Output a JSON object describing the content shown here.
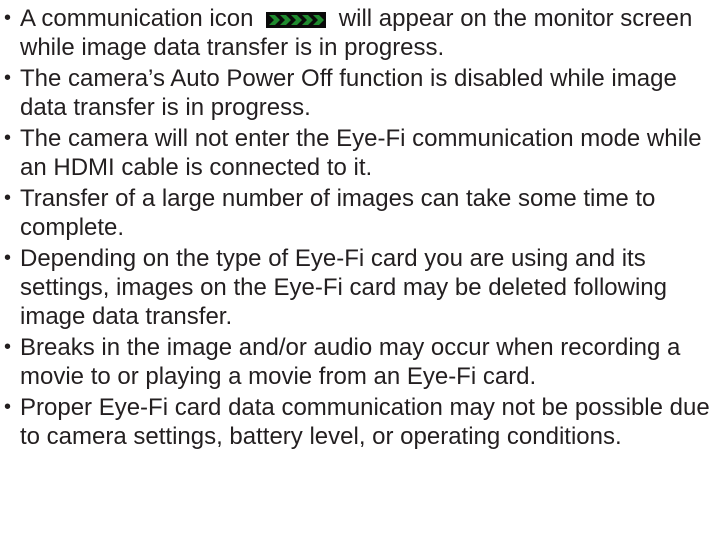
{
  "bullet_char": "•",
  "items": [
    {
      "text_before_icon": "A communication icon",
      "icon": "eye-fi-communication-icon",
      "text_after_icon": "will appear on the monitor screen while image data transfer is in progress."
    },
    {
      "text": "The camera’s Auto Power Off function is disabled while image data transfer is in progress."
    },
    {
      "text": "The camera will not enter the Eye-Fi communication mode while an HDMI cable is connected to it."
    },
    {
      "text": "Transfer of a large number of images can take some time to complete."
    },
    {
      "text": "Depending on the type of Eye-Fi card you are using and its settings, images on the Eye-Fi card may be deleted following image data transfer."
    },
    {
      "text": "Breaks in the image and/or audio may occur when recording a movie to or playing a movie from an Eye-Fi card."
    },
    {
      "text": "Proper Eye-Fi card data communication may not be possible due to camera settings, battery level, or operating conditions."
    }
  ],
  "colors": {
    "text": "#231f20",
    "icon_fill": "#1f8a2e",
    "icon_outline": "#0a0a0a"
  }
}
